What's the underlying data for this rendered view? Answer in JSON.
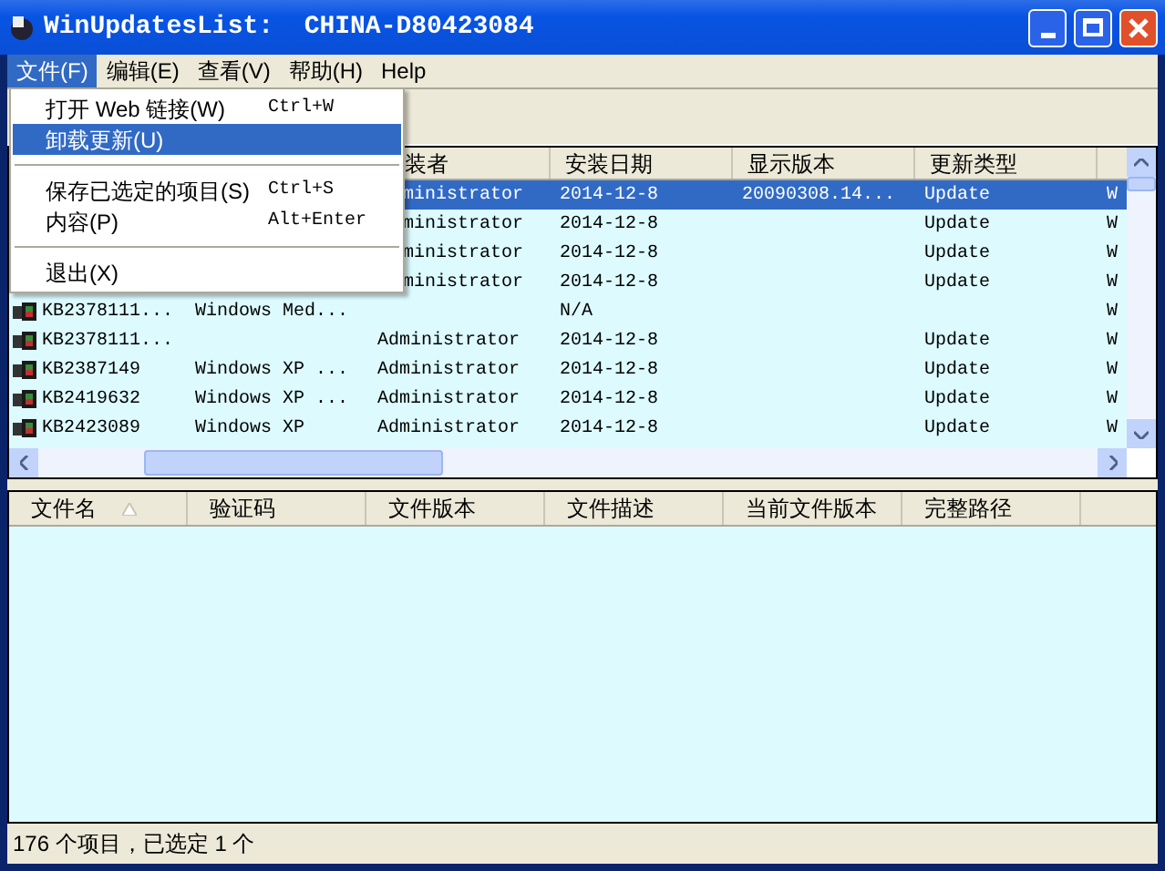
{
  "window": {
    "title": "WinUpdatesList:  CHINA-D80423084"
  },
  "menu_bar": [
    {
      "label": "文件(F)",
      "selected": true
    },
    {
      "label": "编辑(E)",
      "selected": false
    },
    {
      "label": "查看(V)",
      "selected": false
    },
    {
      "label": "帮助(H)",
      "selected": false
    },
    {
      "label": "Help",
      "selected": false
    }
  ],
  "file_menu": [
    {
      "kind": "item",
      "label": "打开 Web 链接(W)",
      "shortcut": "Ctrl+W",
      "selected": false
    },
    {
      "kind": "item",
      "label": "卸载更新(U)",
      "selected": true
    },
    {
      "kind": "separator"
    },
    {
      "kind": "item",
      "label": "保存已选定的项目(S)",
      "shortcut": "Ctrl+S",
      "selected": false
    },
    {
      "kind": "item",
      "label": "内容(P)",
      "shortcut": "Alt+Enter",
      "selected": false
    },
    {
      "kind": "separator"
    },
    {
      "kind": "item",
      "label": "退出(X)",
      "selected": false
    }
  ],
  "updates_table": {
    "columns": [
      "",
      "",
      "装者",
      "安装日期",
      "显示版本",
      "更新类型",
      ""
    ],
    "rows": [
      {
        "selected": true,
        "cells": [
          "",
          "",
          "ministrator",
          "2014-12-8",
          "20090308.14...",
          "Update",
          "W"
        ]
      },
      {
        "selected": false,
        "cells": [
          "",
          "",
          "ministrator",
          "2014-12-8",
          "",
          "Update",
          "W"
        ]
      },
      {
        "selected": false,
        "cells": [
          "",
          "",
          "ministrator",
          "2014-12-8",
          "",
          "Update",
          "W"
        ]
      },
      {
        "selected": false,
        "cells": [
          "",
          "",
          "ministrator",
          "2014-12-8",
          "",
          "Update",
          "W"
        ]
      },
      {
        "selected": false,
        "cells": [
          "KB2378111...",
          "Windows Med...",
          "",
          "N/A",
          "",
          "",
          "W"
        ]
      },
      {
        "selected": false,
        "cells": [
          "KB2378111...",
          "",
          "Administrator",
          "2014-12-8",
          "",
          "Update",
          "W"
        ]
      },
      {
        "selected": false,
        "cells": [
          "KB2387149",
          "Windows XP ...",
          "Administrator",
          "2014-12-8",
          "",
          "Update",
          "W"
        ]
      },
      {
        "selected": false,
        "cells": [
          "KB2419632",
          "Windows XP ...",
          "Administrator",
          "2014-12-8",
          "",
          "Update",
          "W"
        ]
      },
      {
        "selected": false,
        "cells": [
          "KB2423089",
          "Windows XP",
          "Administrator",
          "2014-12-8",
          "",
          "Update",
          "W"
        ]
      }
    ]
  },
  "files_table": {
    "columns": [
      "文件名",
      "验证码",
      "文件版本",
      "文件描述",
      "当前文件版本",
      "完整路径"
    ]
  },
  "status_bar": "176 个项目，已选定 1 个"
}
